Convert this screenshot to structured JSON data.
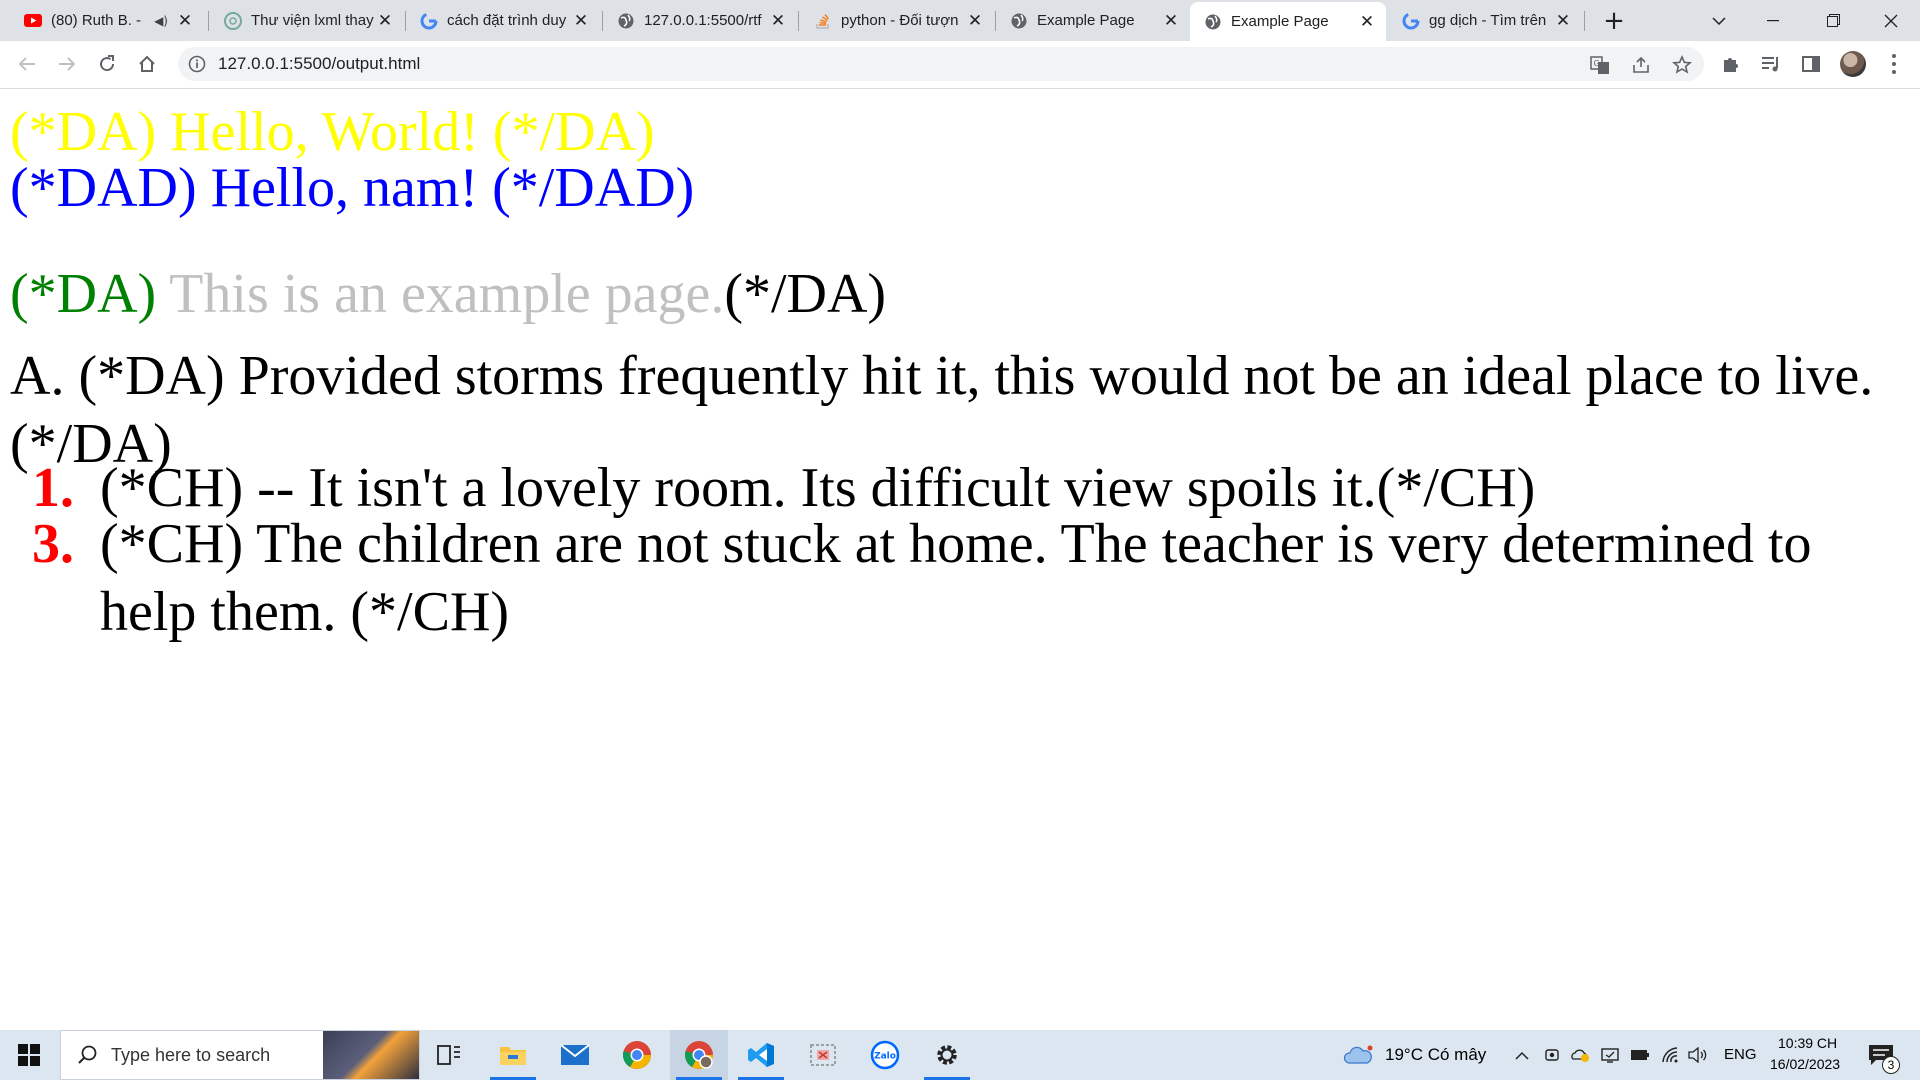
{
  "browser": {
    "tabs": [
      {
        "title": "(80) Ruth B. -",
        "favicon": "youtube-icon",
        "audio": "◀)",
        "active": false
      },
      {
        "title": "Thư viện lxml thay",
        "favicon": "chatgpt-icon",
        "active": false
      },
      {
        "title": "cách đặt trình duy",
        "favicon": "google-icon",
        "active": false
      },
      {
        "title": "127.0.0.1:5500/rtf",
        "favicon": "globe-icon",
        "active": false
      },
      {
        "title": "python - Đối tượn",
        "favicon": "stackoverflow-icon",
        "active": false
      },
      {
        "title": "Example Page",
        "favicon": "globe-icon",
        "active": false
      },
      {
        "title": "Example Page",
        "favicon": "globe-icon",
        "active": true
      },
      {
        "title": "gg dịch - Tìm trên",
        "favicon": "google-icon",
        "active": false
      }
    ],
    "address_bar": {
      "url": "127.0.0.1:5500/output.html"
    }
  },
  "page": {
    "line1": {
      "text": "(*DA) Hello, World! (*/DA)",
      "color": "#ffff00"
    },
    "line2": {
      "text": "(*DAD) Hello, nam! (*/DAD)",
      "color": "#0000ff"
    },
    "line3": {
      "open_tag": "(*DA)",
      "open_color": "#008000",
      "body": " This is an example page.",
      "body_color": "#c0c0c0",
      "close_tag": "(*/DA)"
    },
    "paragraph_a": "A. (*DA) Provided storms frequently hit it, this would not be an ideal place to live. (*/DA)",
    "list": [
      {
        "number": "1.",
        "text": "(*CH) -- It isn't a lovely room. Its difficult view spoils it.(*/CH)"
      },
      {
        "number": "3.",
        "text": "(*CH) The children are not stuck at home. The teacher is very determined to help them.  (*/CH)"
      }
    ],
    "list_number_color": "#ff0000"
  },
  "taskbar": {
    "search_placeholder": "Type here to search",
    "weather": "19°C  Có mây",
    "language": "ENG",
    "time": "10:39 CH",
    "date": "16/02/2023",
    "notification_count": "3"
  }
}
